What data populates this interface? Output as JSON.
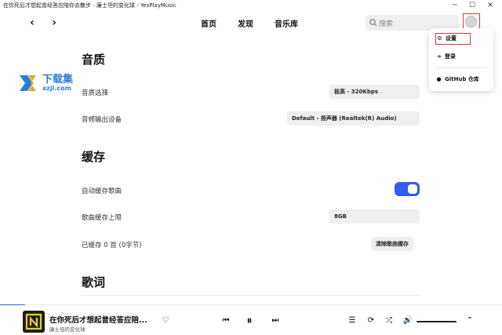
{
  "window": {
    "title": "在你死后才想起曾经答应陪你去散步 - 廉士坦的变化球 - YesPlayMusic",
    "minimize": "─",
    "maximize": "☐",
    "close": "✕"
  },
  "nav": {
    "back": "‹",
    "forward": "›",
    "links": [
      "首页",
      "发现",
      "音乐库"
    ],
    "search_placeholder": "搜索"
  },
  "menu": {
    "items": [
      "设置",
      "登录",
      "GitHub 仓库"
    ]
  },
  "watermark": {
    "name": "下载集",
    "url": "xzji.com"
  },
  "sections": {
    "quality": {
      "title": "音质",
      "rows": [
        {
          "label": "音质选择",
          "value": "极高 - 320Kbps"
        },
        {
          "label": "音频输出设备",
          "value": "Default - 扬声器 (Realtek(R) Audio)"
        }
      ]
    },
    "cache": {
      "title": "缓存",
      "auto_cache_label": "自动缓存歌曲",
      "auto_cache_on": true,
      "limit_label": "歌曲缓存上限",
      "limit_value": "8GB",
      "cached_label": "已缓存 0 首 (0字节)",
      "clear_button": "清除歌曲缓存"
    },
    "lyrics": {
      "title": "歌词"
    }
  },
  "player": {
    "song_title": "在你死后才想起曾经答应陪...",
    "artist": "廉士坦的变化球",
    "progress": 0.05,
    "volume": 1.0
  },
  "colors": {
    "accent": "#335eea",
    "highlight_box": "#e03535",
    "watermark": "#2e7bd6"
  }
}
